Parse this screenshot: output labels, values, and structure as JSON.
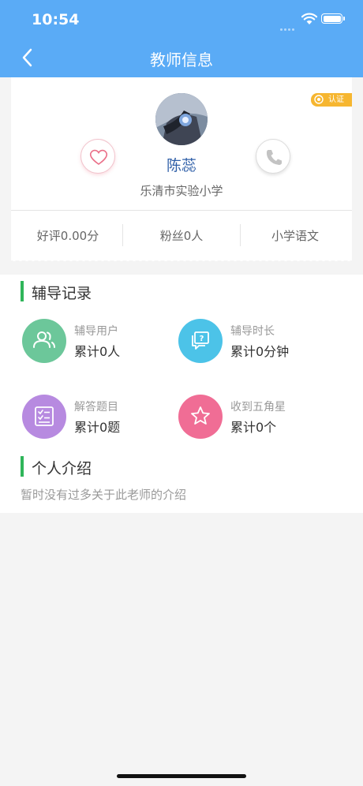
{
  "status_bar": {
    "time": "10:54"
  },
  "nav": {
    "title": "教师信息"
  },
  "profile": {
    "badge": "认证",
    "name": "陈蕊",
    "school": "乐清市实验小学",
    "stats": [
      "好评0.00分",
      "粉丝0人",
      "小学语文"
    ]
  },
  "tutoring": {
    "title": "辅导记录",
    "items": [
      {
        "label": "辅导用户",
        "value": "累计0人",
        "icon": "users-icon",
        "color": "#6cc79a"
      },
      {
        "label": "辅导时长",
        "value": "累计0分钟",
        "icon": "question-chat-icon",
        "color": "#4cc3e8"
      },
      {
        "label": "解答题目",
        "value": "累计0题",
        "icon": "checklist-icon",
        "color": "#b78ae0"
      },
      {
        "label": "收到五角星",
        "value": "累计0个",
        "icon": "star-icon",
        "color": "#f06d95"
      }
    ]
  },
  "intro": {
    "title": "个人介绍",
    "text": "暂时没有过多关于此老师的介绍"
  }
}
